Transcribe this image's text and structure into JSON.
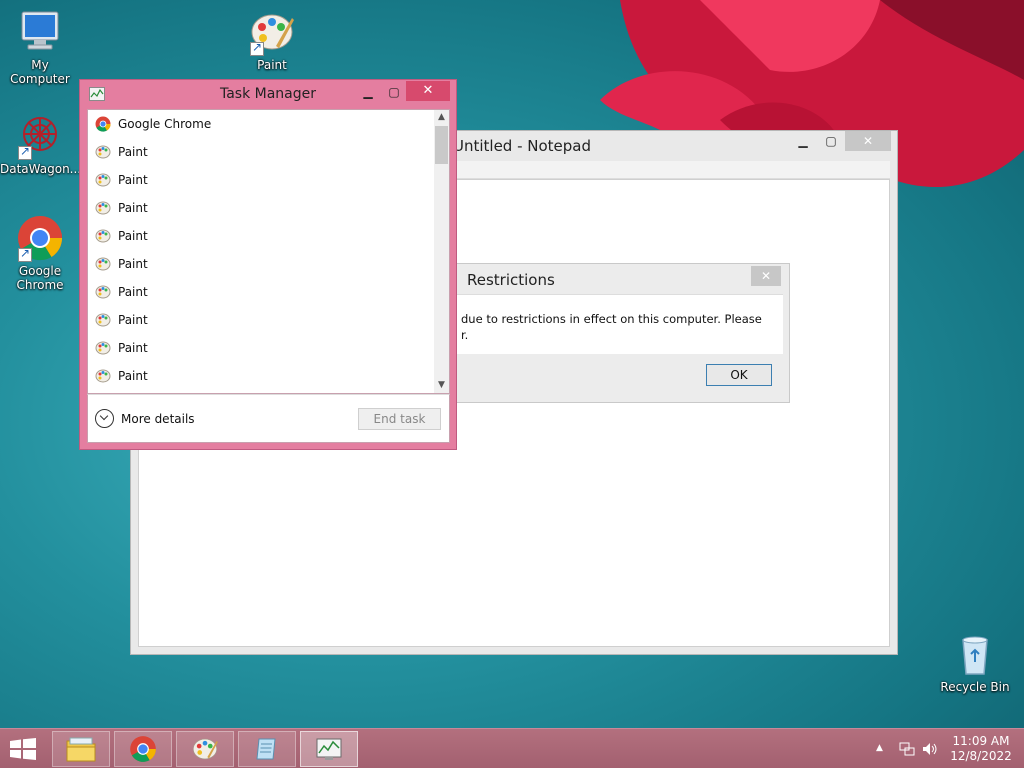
{
  "desktop": {
    "icons": [
      {
        "label": "My Computer",
        "icon": "computer-icon"
      },
      {
        "label": "Paint",
        "icon": "paint-icon"
      },
      {
        "label": "DataWagon...",
        "icon": "datawagon-icon"
      },
      {
        "label": "Google Chrome",
        "icon": "chrome-icon"
      },
      {
        "label": "Recycle Bin",
        "icon": "recycle-bin-icon"
      }
    ]
  },
  "notepad": {
    "title": "Untitled - Notepad"
  },
  "restrictions_dialog": {
    "title": "Restrictions",
    "message_line1": "due to restrictions in effect on this computer. Please",
    "message_line2": "r.",
    "ok_label": "OK"
  },
  "task_manager": {
    "title": "Task Manager",
    "processes": [
      {
        "name": "Google Chrome",
        "icon": "chrome-icon"
      },
      {
        "name": "Paint",
        "icon": "paint-icon"
      },
      {
        "name": "Paint",
        "icon": "paint-icon"
      },
      {
        "name": "Paint",
        "icon": "paint-icon"
      },
      {
        "name": "Paint",
        "icon": "paint-icon"
      },
      {
        "name": "Paint",
        "icon": "paint-icon"
      },
      {
        "name": "Paint",
        "icon": "paint-icon"
      },
      {
        "name": "Paint",
        "icon": "paint-icon"
      },
      {
        "name": "Paint",
        "icon": "paint-icon"
      },
      {
        "name": "Paint",
        "icon": "paint-icon"
      }
    ],
    "more_details_label": "More details",
    "end_task_label": "End task"
  },
  "taskbar": {
    "pinned": [
      "file-explorer-icon",
      "chrome-icon",
      "paint-icon",
      "notepad-icon",
      "task-manager-icon"
    ],
    "time": "11:09 AM",
    "date": "12/8/2022"
  },
  "colors": {
    "accent": "#e47ea0",
    "taskbar": "#a8667a",
    "desktop": "#1f8796"
  }
}
